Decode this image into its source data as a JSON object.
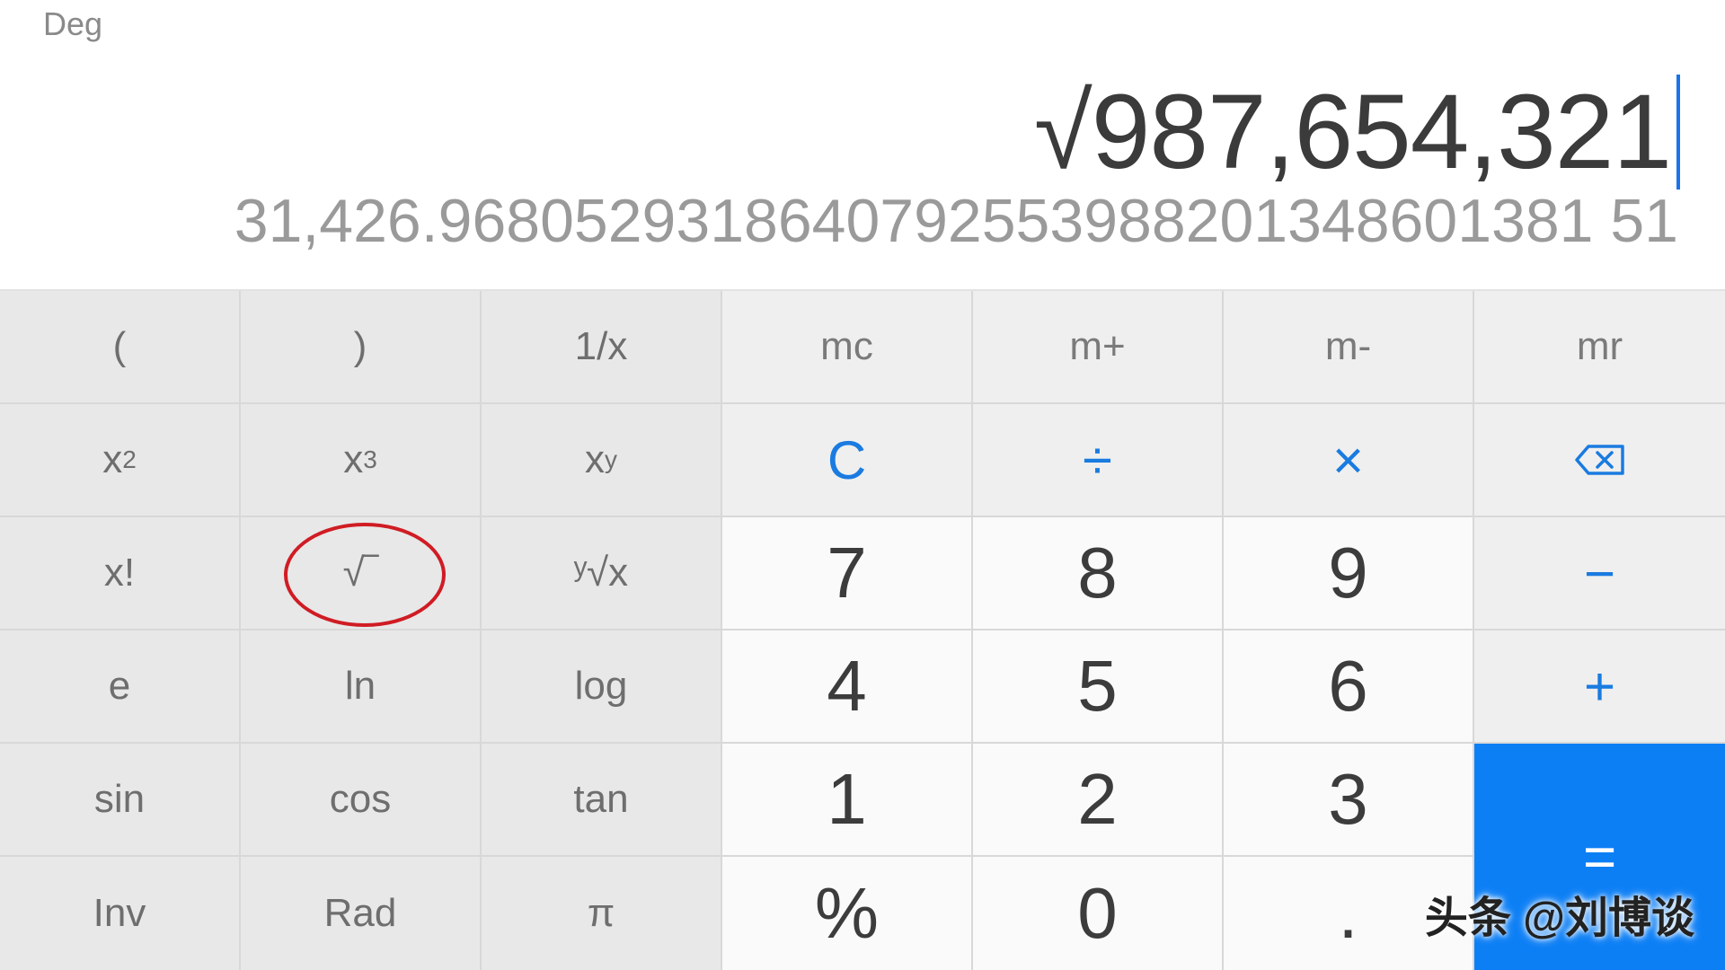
{
  "display": {
    "mode": "Deg",
    "expression": "√987,654,321",
    "result": "31,426.9680529318640792553988201348601381 51"
  },
  "keys": {
    "open_paren": "(",
    "close_paren": ")",
    "reciprocal": "1/x",
    "mc": "mc",
    "m_plus": "m+",
    "m_minus": "m-",
    "mr": "mr",
    "square_base": "x",
    "square_exp": "2",
    "cube_base": "x",
    "cube_exp": "3",
    "power_base": "x",
    "power_exp": "y",
    "clear": "C",
    "divide": "÷",
    "multiply": "×",
    "factorial": "x!",
    "sqrt": "√‾",
    "yroot": "ʸ√x",
    "seven": "7",
    "eight": "8",
    "nine": "9",
    "minus": "−",
    "e": "e",
    "ln": "ln",
    "log": "log",
    "four": "4",
    "five": "5",
    "six": "6",
    "plus": "+",
    "sin": "sin",
    "cos": "cos",
    "tan": "tan",
    "one": "1",
    "two": "2",
    "three": "3",
    "equals": "=",
    "inv": "Inv",
    "rad": "Rad",
    "pi": "π",
    "percent": "%",
    "zero": "0",
    "decimal": "."
  },
  "watermark": "头条 @刘博谈",
  "colors": {
    "accent": "#1a7be0",
    "equals_bg": "#0d7ff5",
    "highlight_ring": "#d01c24"
  }
}
